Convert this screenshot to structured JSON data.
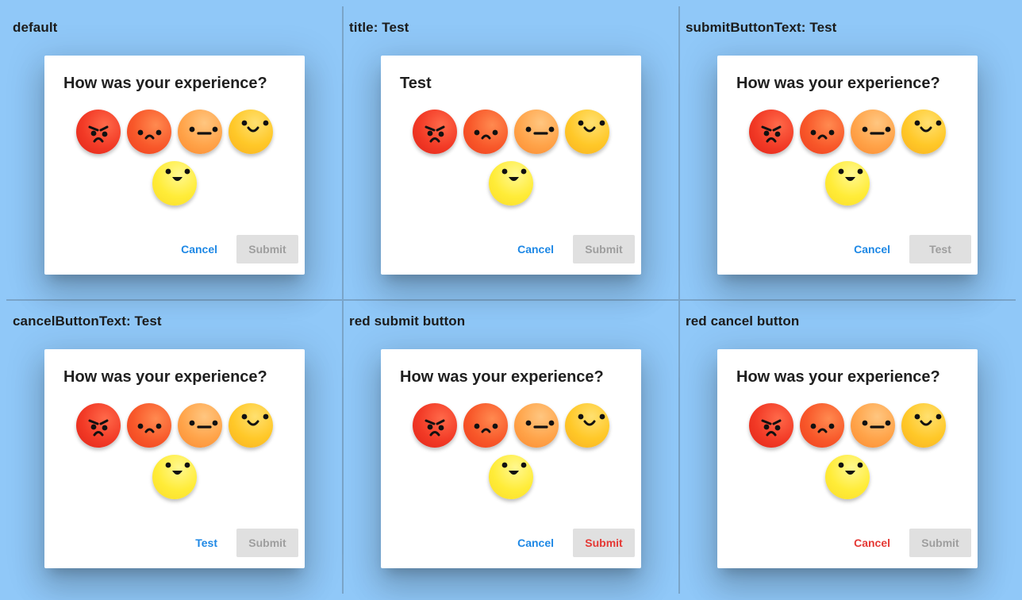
{
  "cells": [
    {
      "label": "default",
      "title": "How was your experience?",
      "cancel": "Cancel",
      "submit": "Submit"
    },
    {
      "label": "title: Test",
      "title": "Test",
      "cancel": "Cancel",
      "submit": "Submit"
    },
    {
      "label": "submitButtonText: Test",
      "title": "How was your experience?",
      "cancel": "Cancel",
      "submit": "Test"
    },
    {
      "label": "cancelButtonText: Test",
      "title": "How was your experience?",
      "cancel": "Test",
      "submit": "Submit"
    },
    {
      "label": "red submit button",
      "title": "How was your experience?",
      "cancel": "Cancel",
      "submit": "Submit"
    },
    {
      "label": "red cancel button",
      "title": "How was your experience?",
      "cancel": "Cancel",
      "submit": "Submit"
    }
  ],
  "emojis": [
    "angry-face-icon",
    "sad-face-icon",
    "neutral-face-icon",
    "smiling-face-icon",
    "happy-face-icon"
  ],
  "colors": {
    "background": "#90c8f8",
    "primary_button_text": "#1e88e5",
    "red_button_text": "#e53935",
    "disabled_button_bg": "#e0e0e0",
    "disabled_button_text": "#9e9e9e"
  }
}
